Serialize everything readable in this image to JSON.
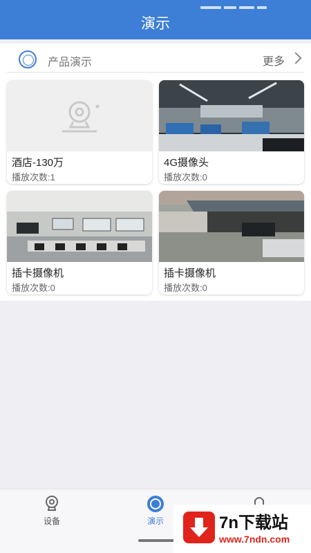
{
  "header": {
    "title": "演示"
  },
  "section": {
    "title": "产品演示",
    "more_label": "更多"
  },
  "devices": [
    {
      "name": "酒店-130万",
      "plays": "播放次数:1",
      "thumbnail": "camera-placeholder"
    },
    {
      "name": "4G摄像头",
      "plays": "播放次数:0",
      "thumbnail": "office-photo"
    },
    {
      "name": "插卡摄像机",
      "plays": "播放次数:0",
      "thumbnail": "meeting-room-photo"
    },
    {
      "name": "插卡摄像机",
      "plays": "播放次数:0",
      "thumbnail": "yard-photo"
    }
  ],
  "tabbar": {
    "tabs": [
      {
        "label": "设备",
        "icon": "camera-icon",
        "active": false
      },
      {
        "label": "演示",
        "icon": "play-circle-icon",
        "active": true
      },
      {
        "label": "",
        "icon": "user-icon",
        "active": false
      }
    ]
  },
  "watermark": {
    "title": "7n下载站",
    "url": "www.7ndn.com"
  },
  "colors": {
    "primary": "#3d7ed6",
    "background": "#eeeef3",
    "watermark_red": "#e1241b"
  }
}
